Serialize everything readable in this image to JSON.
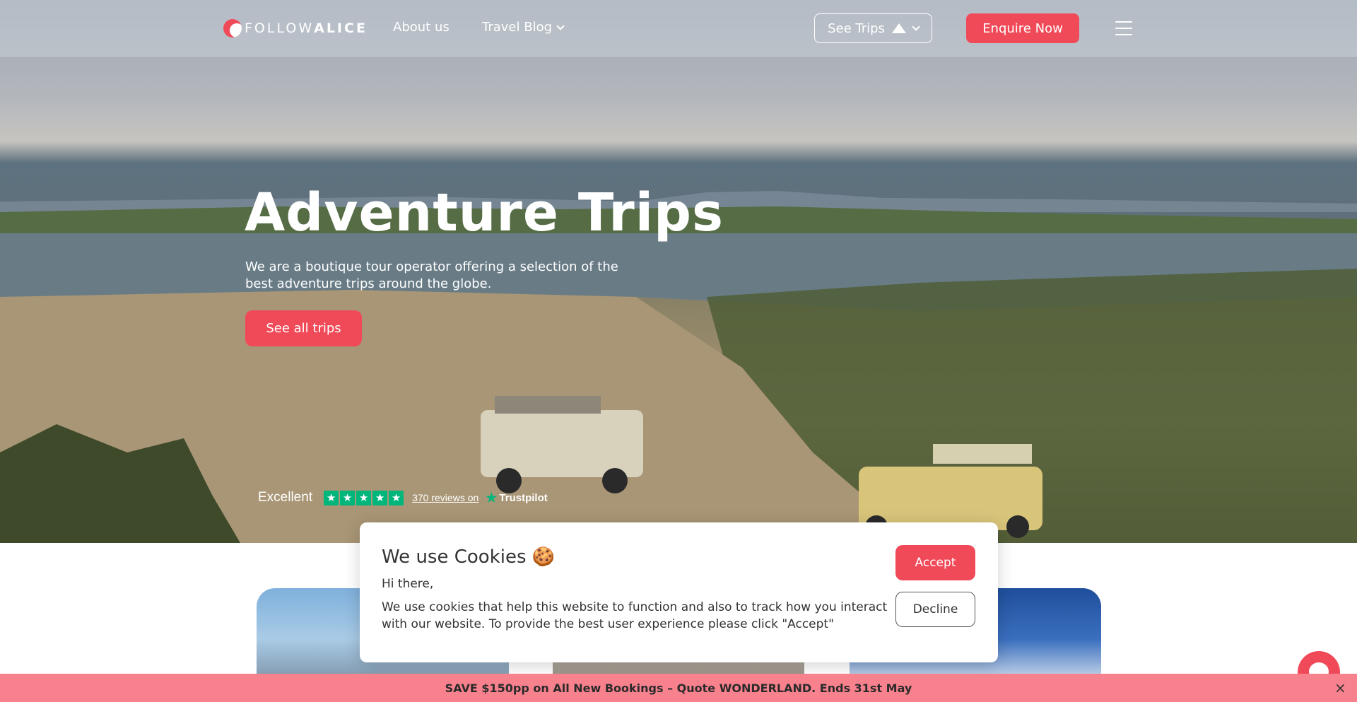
{
  "nav": {
    "logo_text_light": "FOLLOW",
    "logo_text_bold": "ALICE",
    "links": [
      {
        "label": "About us"
      },
      {
        "label": "Travel Blog"
      }
    ],
    "see_trips_label": "See Trips",
    "enquire_label": "Enquire Now"
  },
  "hero": {
    "title": "Adventure Trips",
    "subtitle": "We are a boutique tour operator offering a selection of the best adventure trips around the globe.",
    "cta_label": "See all trips"
  },
  "trustpilot": {
    "rating_text": "Excellent",
    "stars": 5,
    "reviews_text": "370 reviews on",
    "brand": "Trustpilot"
  },
  "cookie": {
    "title": "We use Cookies 🍪",
    "greeting": "Hi there,",
    "body": "We use cookies that help this website to function and also to track how you interact with our website. To provide the best user experience please click \"Accept\"",
    "accept_label": "Accept",
    "decline_label": "Decline"
  },
  "promo": {
    "text": "SAVE $150pp on All New Bookings – Quote WONDERLAND. Ends 31st May",
    "close_icon": "×"
  },
  "colors": {
    "accent": "#f04a59",
    "promo_bg": "#f7818d",
    "trustpilot_green": "#00b67a"
  }
}
